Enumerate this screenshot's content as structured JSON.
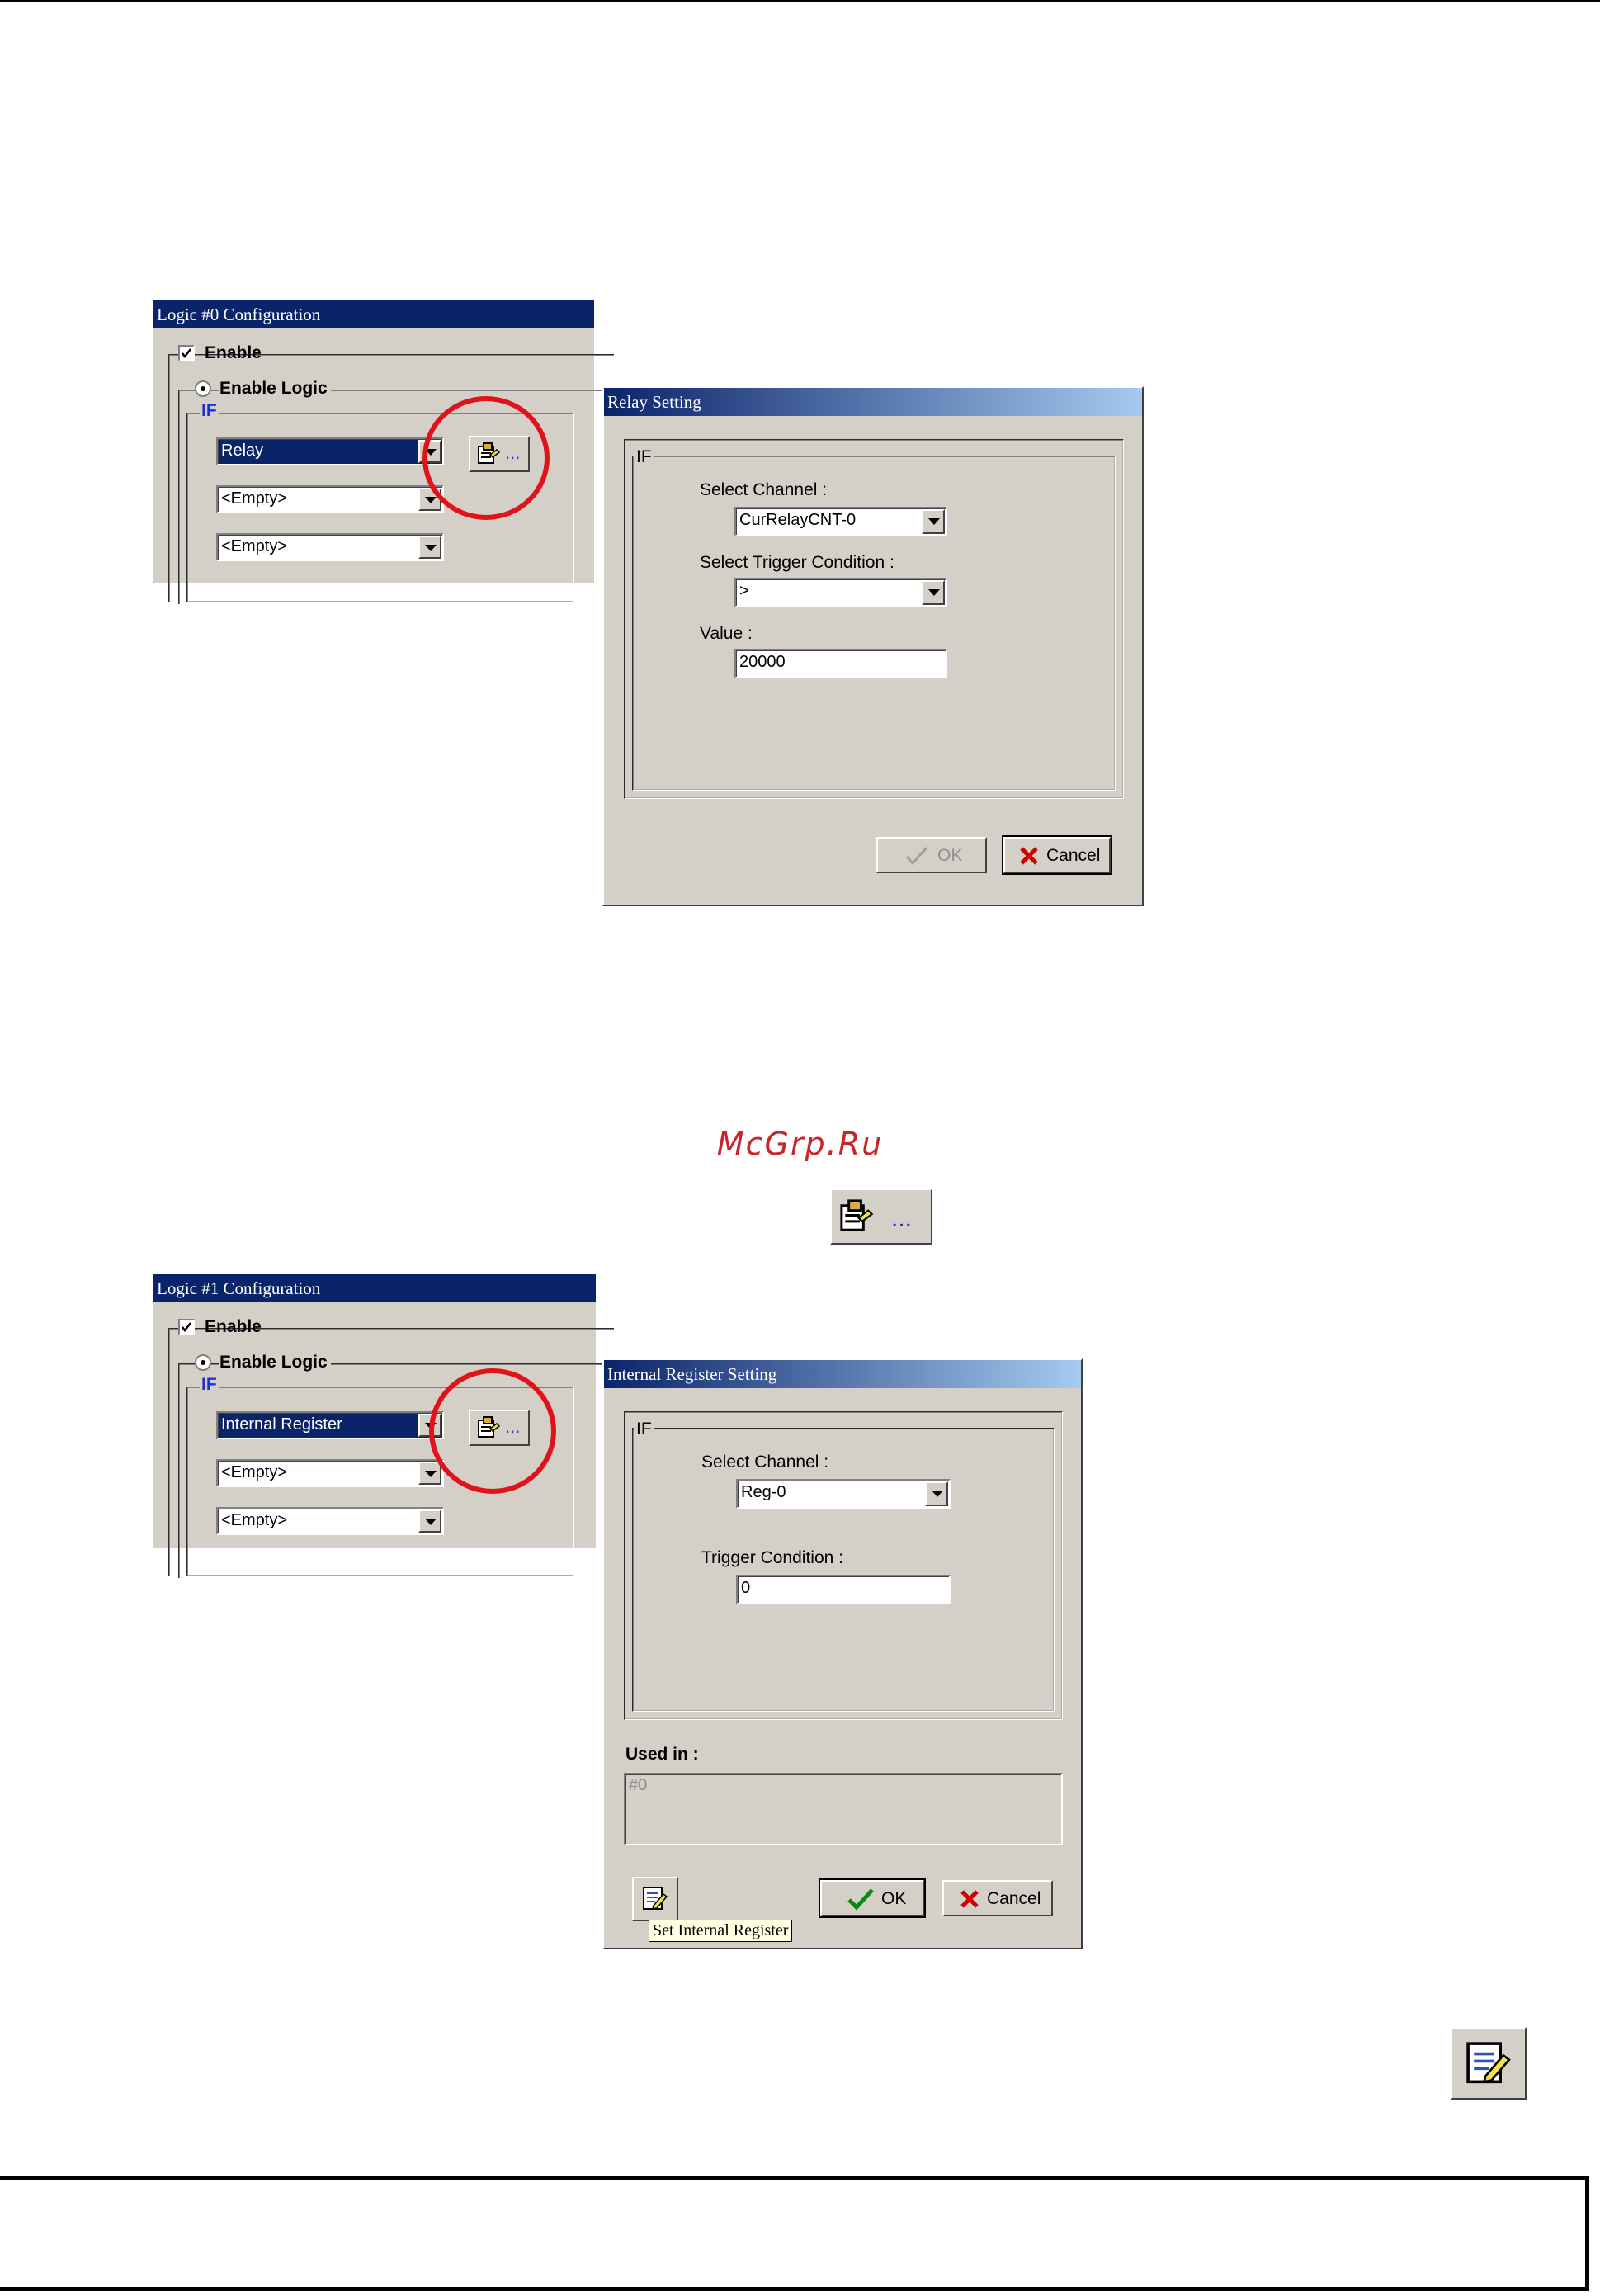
{
  "watermark": "McGrp.Ru",
  "figure1": {
    "logic_window": {
      "title": "Logic #0 Configuration",
      "enable_label": "Enable",
      "enable_logic_label": "Enable Logic",
      "if_label": "IF",
      "selects": [
        "Relay",
        "<Empty>",
        "<Empty>"
      ],
      "browse_button_label": "..."
    },
    "relay_dialog": {
      "title": "Relay Setting",
      "group_label": "IF",
      "channel_label": "Select Channel :",
      "channel_value": "CurRelayCNT-0",
      "trigger_label": "Select Trigger Condition :",
      "trigger_value": ">",
      "value_label": "Value :",
      "value_value": "20000",
      "ok_label": "OK",
      "cancel_label": "Cancel"
    }
  },
  "inline_button_label": "...",
  "figure2": {
    "logic_window": {
      "title": "Logic #1 Configuration",
      "enable_label": "Enable",
      "enable_logic_label": "Enable Logic",
      "if_label": "IF",
      "selects": [
        "Internal Register",
        "<Empty>",
        "<Empty>"
      ],
      "browse_button_label": "..."
    },
    "register_dialog": {
      "title": "Internal Register Setting",
      "group_label": "IF",
      "channel_label": "Select Channel :",
      "channel_value": "Reg-0",
      "trigger_label": "Trigger Condition :",
      "trigger_value": "0",
      "used_in_label": "Used in :",
      "used_in_value": "#0",
      "ok_label": "OK",
      "cancel_label": "Cancel",
      "tooltip": "Set Internal Register"
    }
  },
  "colors": {
    "dialog_bg": "#d4d0c8",
    "title_bar": "#0a246a",
    "highlight_circle": "#e0121a",
    "watermark": "#c8262b"
  }
}
